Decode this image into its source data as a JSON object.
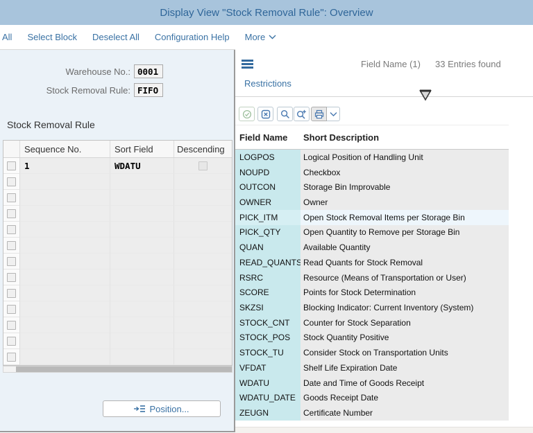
{
  "title_bar": {
    "title": "Display View \"Stock Removal Rule\": Overview"
  },
  "menubar": {
    "items": [
      "All",
      "Select Block",
      "Deselect All",
      "Configuration Help"
    ],
    "more_label": "More"
  },
  "form": {
    "warehouse": {
      "label": "Warehouse No.:",
      "value": "0001"
    },
    "rule": {
      "label": "Stock Removal Rule:",
      "value": "FIFO"
    }
  },
  "sequence_section": {
    "title": "Stock Removal Rule",
    "columns": [
      "Sequence No.",
      "Sort Field",
      "Descending"
    ],
    "rows": [
      {
        "sequence_no": "1",
        "sort_field": "WDATU",
        "descending": false
      }
    ],
    "empty_row_count": 12,
    "position_button_label": "Position..."
  },
  "value_help": {
    "title": "Field Name (1)",
    "entries_found": "33 Entries found",
    "restrictions_label": "Restrictions",
    "toolbar_icons": [
      "accept",
      "cancel",
      "search",
      "search-more",
      "print",
      "print-options"
    ],
    "columns": [
      "Field Name",
      "Short Description"
    ],
    "highlight_index": 4,
    "rows": [
      [
        "LOGPOS",
        "Logical Position of Handling Unit"
      ],
      [
        "NOUPD",
        "Checkbox"
      ],
      [
        "OUTCON",
        "Storage Bin Improvable"
      ],
      [
        "OWNER",
        "Owner"
      ],
      [
        "PICK_ITM",
        "Open Stock Removal Items per Storage Bin"
      ],
      [
        "PICK_QTY",
        "Open Quantity to Remove per Storage Bin"
      ],
      [
        "QUAN",
        "Available Quantity"
      ],
      [
        "READ_QUANTS",
        "Read Quants for Stock Removal"
      ],
      [
        "RSRC",
        "Resource (Means of Transportation or User)"
      ],
      [
        "SCORE",
        "Points for Stock Determination"
      ],
      [
        "SKZSI",
        "Blocking Indicator: Current Inventory (System)"
      ],
      [
        "STOCK_CNT",
        "Counter for Stock Separation"
      ],
      [
        "STOCK_POS",
        "Stock Quantity Positive"
      ],
      [
        "STOCK_TU",
        "Consider Stock on Transportation Units"
      ],
      [
        "VFDAT",
        "Shelf Life Expiration Date"
      ],
      [
        "WDATU",
        "Date and Time of Goods Receipt"
      ],
      [
        "WDATU_DATE",
        "Goods Receipt Date"
      ],
      [
        "ZEUGN",
        "Certificate Number"
      ]
    ]
  },
  "colors": {
    "title_bar_bg": "#a8c4dc",
    "title_text": "#2f6699",
    "link_blue": "#3a72a4",
    "panel_bg": "#ebf2f8",
    "field_name_col_bg": "#c9e9ed",
    "desc_col_bg": "#ebebeb",
    "highlight_row_bg": "#eef6fc"
  }
}
